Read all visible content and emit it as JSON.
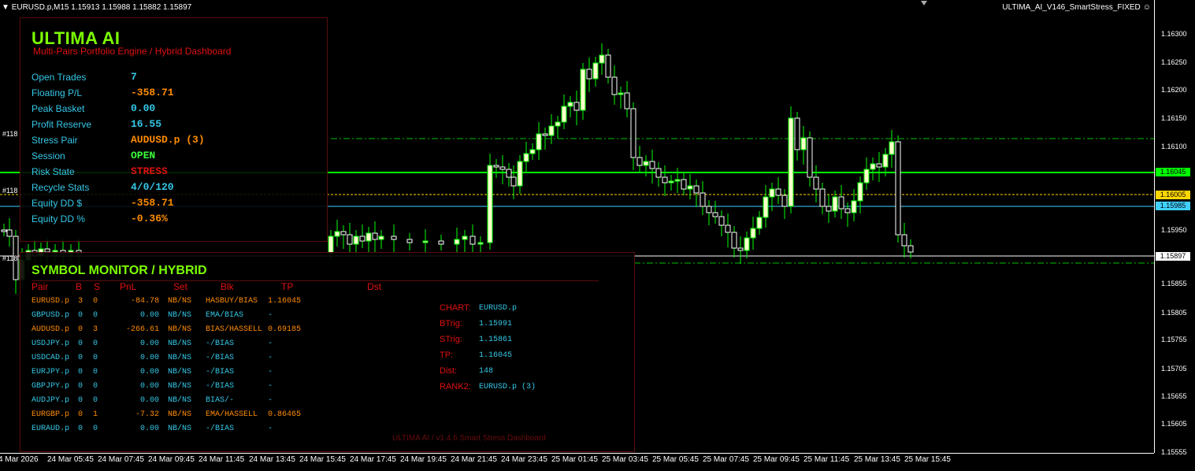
{
  "window": {
    "symbol_line": "EURUSD.p,M15  1.15913 1.15988 1.15882 1.15897",
    "ea_name": "ULTIMA_AI_V146_SmartStress_FIXED"
  },
  "colors": {
    "bull_candle": "#ffffcc",
    "bear_candle": "#ffffff",
    "wick": "#00ff00",
    "accent_green": "#7cff00",
    "accent_red": "#e01010",
    "accent_cyan": "#34c8e8",
    "accent_orange": "#ff8c00"
  },
  "price_scale": {
    "labels": [
      "1.16300",
      "1.16250",
      "1.16200",
      "1.16150",
      "1.16100",
      "1.15950",
      "1.15855",
      "1.15805",
      "1.15755",
      "1.15705",
      "1.15655",
      "1.15605",
      "1.15555"
    ],
    "tags": [
      {
        "value": "1.16045",
        "bg": "#00ff00"
      },
      {
        "value": "1.16005",
        "bg": "#ffd700"
      },
      {
        "value": "1.15985",
        "bg": "#40d0ff"
      },
      {
        "value": "1.15897",
        "bg": "#ffffff"
      }
    ]
  },
  "time_axis": [
    "4 Mar 2026",
    "24 Mar 05:45",
    "24 Mar 07:45",
    "24 Mar 09:45",
    "24 Mar 11:45",
    "24 Mar 13:45",
    "24 Mar 15:45",
    "24 Mar 17:45",
    "24 Mar 19:45",
    "24 Mar 21:45",
    "24 Mar 23:45",
    "25 Mar 01:45",
    "25 Mar 03:45",
    "25 Mar 05:45",
    "25 Mar 07:45",
    "25 Mar 09:45",
    "25 Mar 11:45",
    "25 Mar 13:45",
    "25 Mar 15:45"
  ],
  "tickets": [
    "#118",
    "#118",
    "#118"
  ],
  "main_panel": {
    "title": "ULTIMA AI",
    "subtitle": "Multi-Pairs Portfolio Engine / Hybrid Dashboard",
    "stats": [
      {
        "label": "Open Trades",
        "value": "7",
        "color": "#34c8e8"
      },
      {
        "label": "Floating P/L",
        "value": "-358.71",
        "color": "#ff8c00"
      },
      {
        "label": "Peak Basket",
        "value": "0.00",
        "color": "#34c8e8"
      },
      {
        "label": "Profit Reserve",
        "value": "16.55",
        "color": "#34c8e8"
      },
      {
        "label": "Stress Pair",
        "value": "AUDUSD.p (3)",
        "color": "#ff8c00"
      },
      {
        "label": "Session",
        "value": "OPEN",
        "color": "#3cff3c"
      },
      {
        "label": "Risk State",
        "value": "STRESS",
        "color": "#e01010"
      },
      {
        "label": "Recycle Stats",
        "value": "4/0/120",
        "color": "#34c8e8"
      },
      {
        "label": "Equity DD $",
        "value": "-358.71",
        "color": "#ff8c00"
      },
      {
        "label": "Equity DD %",
        "value": "-0.36%",
        "color": "#ff8c00"
      }
    ]
  },
  "monitor": {
    "title": "SYMBOL MONITOR / HYBRID",
    "columns": [
      "Pair",
      "B",
      "S",
      "PnL",
      "Set",
      "Blk",
      "TP",
      "Dst"
    ],
    "rows": [
      {
        "pair": "EURUSD.p",
        "b": "3",
        "s": "0",
        "pnl": "-84.78",
        "set": "NB/NS",
        "blk": "HASBUY/BIAS",
        "tp": "1.16045",
        "color": "#ff8c00"
      },
      {
        "pair": "GBPUSD.p",
        "b": "0",
        "s": "0",
        "pnl": "0.00",
        "set": "NB/NS",
        "blk": "EMA/BIAS",
        "tp": "-",
        "color": "#34c8e8"
      },
      {
        "pair": "AUDUSD.p",
        "b": "0",
        "s": "3",
        "pnl": "-266.61",
        "set": "NB/NS",
        "blk": "BIAS/HASSELL",
        "tp": "0.69185",
        "color": "#ff8c00"
      },
      {
        "pair": "USDJPY.p",
        "b": "0",
        "s": "0",
        "pnl": "0.00",
        "set": "NB/NS",
        "blk": "-/BIAS",
        "tp": "-",
        "color": "#34c8e8"
      },
      {
        "pair": "USDCAD.p",
        "b": "0",
        "s": "0",
        "pnl": "0.00",
        "set": "NB/NS",
        "blk": "-/BIAS",
        "tp": "-",
        "color": "#34c8e8"
      },
      {
        "pair": "EURJPY.p",
        "b": "0",
        "s": "0",
        "pnl": "0.00",
        "set": "NB/NS",
        "blk": "-/BIAS",
        "tp": "-",
        "color": "#34c8e8"
      },
      {
        "pair": "GBPJPY.p",
        "b": "0",
        "s": "0",
        "pnl": "0.00",
        "set": "NB/NS",
        "blk": "-/BIAS",
        "tp": "-",
        "color": "#34c8e8"
      },
      {
        "pair": "AUDJPY.p",
        "b": "0",
        "s": "0",
        "pnl": "0.00",
        "set": "NB/NS",
        "blk": "BIAS/-",
        "tp": "-",
        "color": "#34c8e8"
      },
      {
        "pair": "EURGBP.p",
        "b": "0",
        "s": "1",
        "pnl": "-7.32",
        "set": "NB/NS",
        "blk": "EMA/HASSELL",
        "tp": "0.86465",
        "color": "#ff8c00"
      },
      {
        "pair": "EURAUD.p",
        "b": "0",
        "s": "0",
        "pnl": "0.00",
        "set": "NB/NS",
        "blk": "-/BIAS",
        "tp": "-",
        "color": "#34c8e8"
      }
    ],
    "info": [
      {
        "label": "CHART:",
        "value": "EURUSD.p"
      },
      {
        "label": "BTrig:",
        "value": "1.15991"
      },
      {
        "label": "STrig:",
        "value": "1.15861"
      },
      {
        "label": "TP:",
        "value": "1.16045"
      },
      {
        "label": "Dist:",
        "value": "148"
      },
      {
        "label": "RANK2:",
        "value": "EURUSD.p (3)"
      }
    ],
    "footer": "ULTIMA AI / v1.4.6 Smart Stress Dashboard"
  }
}
